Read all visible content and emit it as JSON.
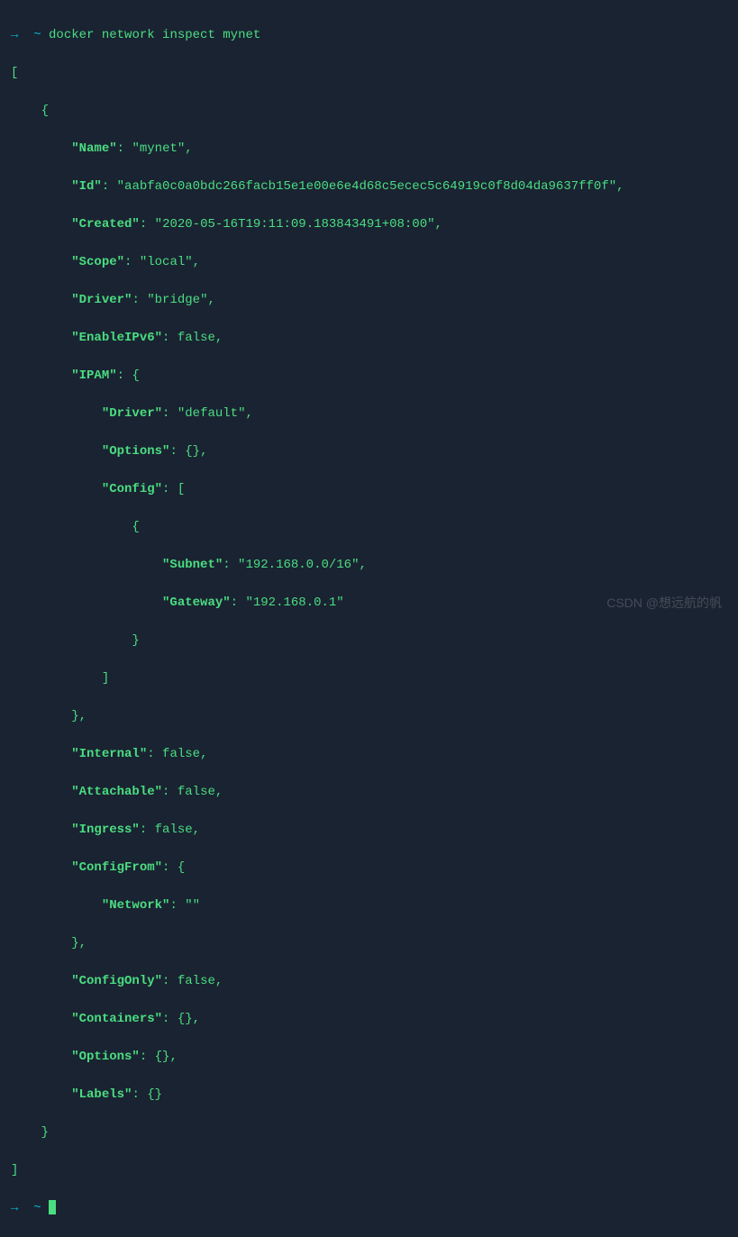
{
  "prompt": {
    "arrow": "→",
    "tilde": "~",
    "command": "docker network inspect mynet"
  },
  "output": {
    "Name": "mynet",
    "Id": "aabfa0c0a0bdc266facb15e1e00e6e4d68c5ecec5c64919c0f8d04da9637ff0f",
    "Created": "2020-05-16T19:11:09.183843491+08:00",
    "Scope": "local",
    "Driver": "bridge",
    "EnableIPv6": "false",
    "IPAM_Driver": "default",
    "IPAM_Options": "{}",
    "IPAM_Subnet": "192.168.0.0/16",
    "IPAM_Gateway": "192.168.0.1",
    "Internal": "false",
    "Attachable": "false",
    "Ingress": "false",
    "ConfigFrom_Network": "",
    "ConfigOnly": "false",
    "Containers": "{}",
    "Options": "{}",
    "Labels": "{}"
  },
  "keys": {
    "Name": "\"Name\"",
    "Id": "\"Id\"",
    "Created": "\"Created\"",
    "Scope": "\"Scope\"",
    "Driver": "\"Driver\"",
    "EnableIPv6": "\"EnableIPv6\"",
    "IPAM": "\"IPAM\"",
    "IPAM_Driver": "\"Driver\"",
    "IPAM_Options": "\"Options\"",
    "IPAM_Config": "\"Config\"",
    "Subnet": "\"Subnet\"",
    "Gateway": "\"Gateway\"",
    "Internal": "\"Internal\"",
    "Attachable": "\"Attachable\"",
    "Ingress": "\"Ingress\"",
    "ConfigFrom": "\"ConfigFrom\"",
    "Network": "\"Network\"",
    "ConfigOnly": "\"ConfigOnly\"",
    "Containers": "\"Containers\"",
    "Options": "\"Options\"",
    "Labels": "\"Labels\""
  },
  "watermark": "CSDN @想远航的帆"
}
